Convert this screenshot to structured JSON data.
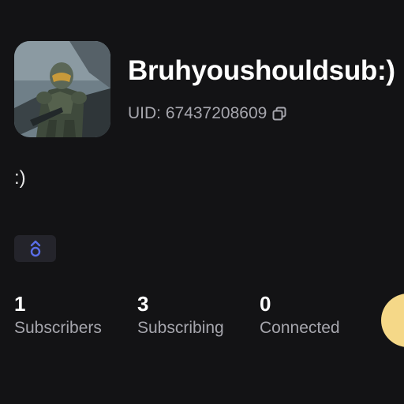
{
  "profile": {
    "username": "Bruhyoushouldsub:)",
    "uid_text": "UID: 67437208609",
    "bio": ":)",
    "avatar_icon": "armored-soldier-avatar"
  },
  "badge": {
    "icon": "rank-chevron-icon",
    "color": "#5a6ee8"
  },
  "stats": [
    {
      "value": "1",
      "label": "Subscribers"
    },
    {
      "value": "3",
      "label": "Subscribing"
    },
    {
      "value": "0",
      "label": "Connected"
    }
  ],
  "colors": {
    "background": "#131315",
    "secondary_text": "#a6a6ad",
    "fab": "#f5d888"
  }
}
